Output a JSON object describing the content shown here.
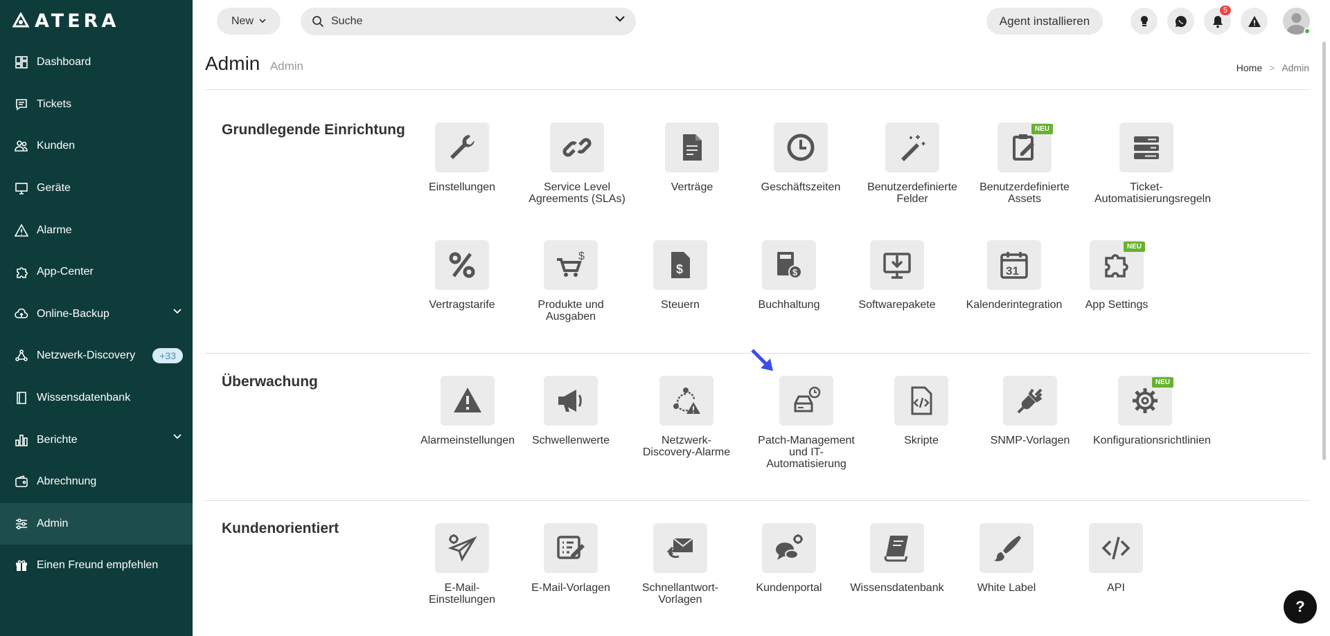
{
  "brand": {
    "name": "ATERA"
  },
  "sidebar": {
    "items": [
      {
        "label": "Dashboard",
        "icon": "dashboard-icon"
      },
      {
        "label": "Tickets",
        "icon": "ticket-icon"
      },
      {
        "label": "Kunden",
        "icon": "users-icon"
      },
      {
        "label": "Geräte",
        "icon": "monitor-icon"
      },
      {
        "label": "Alarme",
        "icon": "alert-icon"
      },
      {
        "label": "App-Center",
        "icon": "puzzle-icon"
      },
      {
        "label": "Online-Backup",
        "icon": "cloud-icon"
      },
      {
        "label": "Netzwerk-Discovery",
        "icon": "network-icon",
        "badge": "+33"
      },
      {
        "label": "Wissensdatenbank",
        "icon": "book-icon"
      },
      {
        "label": "Berichte",
        "icon": "chart-icon"
      },
      {
        "label": "Abrechnung",
        "icon": "wallet-icon"
      },
      {
        "label": "Admin",
        "icon": "sliders-icon"
      },
      {
        "label": "Einen Freund empfehlen",
        "icon": "gift-icon"
      }
    ]
  },
  "topbar": {
    "new_label": "New",
    "search_placeholder": "Suche",
    "agent_label": "Agent installieren",
    "notification_count": "5"
  },
  "header": {
    "title": "Admin",
    "subtitle": "Admin",
    "crumb_home": "Home",
    "crumb_sep": ">",
    "crumb_current": "Admin"
  },
  "neu_label": "NEU",
  "sections": {
    "basic": {
      "title": "Grundlegende Einrichtung",
      "row1": [
        "Einstellungen",
        "Service Level\nAgreements (SLAs)",
        "Verträge",
        "Geschäftszeiten",
        "Benutzerdefinierte\nFelder",
        "Benutzerdefinierte\nAssets",
        "Ticket-\nAutomatisierungsregeln"
      ],
      "row2": [
        "Vertragstarife",
        "Produkte und\nAusgaben",
        "Steuern",
        "Buchhaltung",
        "Softwarepakete",
        "Kalenderintegration",
        "App Settings"
      ]
    },
    "monitoring": {
      "title": "Überwachung",
      "items": [
        "Alarmeinstellungen",
        "Schwellenwerte",
        "Netzwerk-\nDiscovery-Alarme",
        "Patch-Management\nund IT-\nAutomatisierung",
        "Skripte",
        "SNMP-Vorlagen",
        "Konfigurationsrichtlinien"
      ]
    },
    "customer": {
      "title": "Kundenorientiert",
      "items": [
        "E-Mail-\nEinstellungen",
        "E-Mail-Vorlagen",
        "Schnellantwort-\nVorlagen",
        "Kundenportal",
        "Wissensdatenbank",
        "White Label",
        "API"
      ]
    }
  },
  "help_label": "?",
  "colors": {
    "sidebar_bg": "#0e3c3a",
    "sidebar_active": "#1e4e4b",
    "neu_badge": "#66b22e",
    "icon_gray": "#555555",
    "tile_bg": "#ebebeb"
  }
}
